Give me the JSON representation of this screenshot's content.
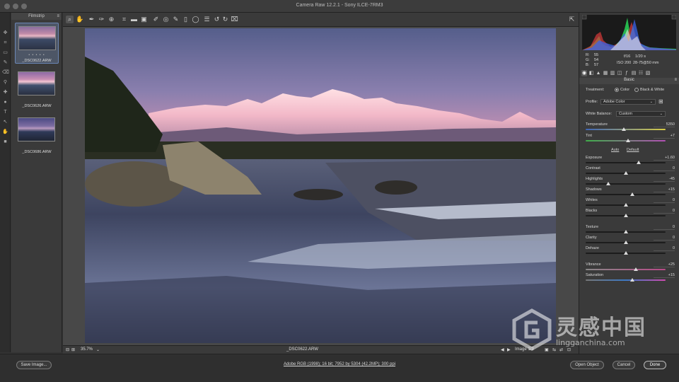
{
  "window": {
    "title": "Camera Raw 12.2.1  -  Sony ILCE-7RM3"
  },
  "filmstrip": {
    "header": "Filmstrip",
    "items": [
      {
        "label": "_DSC0622.ARW",
        "stars": "• • • • •",
        "selected": true
      },
      {
        "label": "_DSC0626.ARW",
        "stars": "",
        "selected": false
      },
      {
        "label": "_DSC0686.ARW",
        "stars": "",
        "selected": false
      }
    ]
  },
  "toolbar": {
    "tools": [
      "zoom-icon",
      "hand-icon",
      "white-balance-icon",
      "color-sampler-icon",
      "target-adjust-icon",
      "crop-icon",
      "straighten-icon",
      "transform-icon",
      "spot-removal-icon",
      "red-eye-icon",
      "adjustment-brush-icon",
      "graduated-filter-icon",
      "radial-filter-icon",
      "preferences-icon",
      "rotate-left-icon",
      "rotate-right-icon",
      "trash-icon"
    ],
    "fullscreen": "fullscreen-icon"
  },
  "canvas": {
    "zoom": "35.7%",
    "filename": "_DSC0622.ARW",
    "image_counter": "Image 1/3"
  },
  "histogram": {
    "r_label": "R:",
    "r_val": "55",
    "g_label": "G:",
    "g_val": "54",
    "b_label": "B:",
    "b_val": "57",
    "aperture": "f/16",
    "shutter": "1/20 s",
    "iso": "ISO 200",
    "lens": "28-75@50 mm"
  },
  "panel": {
    "section_title": "Basic",
    "treatment_label": "Treatment:",
    "treatment_color": "Color",
    "treatment_bw": "Black & White",
    "profile_label": "Profile:",
    "profile_value": "Adobe Color",
    "wb_label": "White Balance:",
    "wb_value": "Custom",
    "auto_label": "Auto",
    "default_label": "Default",
    "sliders": [
      {
        "label": "Temperature",
        "value": "5350",
        "pos": 0.48,
        "style": "temp"
      },
      {
        "label": "Tint",
        "value": "+7",
        "pos": 0.53,
        "style": "tint"
      },
      {
        "label": "Exposure",
        "value": "+1.60",
        "pos": 0.66,
        "style": ""
      },
      {
        "label": "Contrast",
        "value": "0",
        "pos": 0.5,
        "style": ""
      },
      {
        "label": "Highlights",
        "value": "-45",
        "pos": 0.28,
        "style": ""
      },
      {
        "label": "Shadows",
        "value": "+15",
        "pos": 0.58,
        "style": ""
      },
      {
        "label": "Whites",
        "value": "0",
        "pos": 0.5,
        "style": ""
      },
      {
        "label": "Blacks",
        "value": "0",
        "pos": 0.5,
        "style": ""
      },
      {
        "label": "Texture",
        "value": "0",
        "pos": 0.5,
        "style": ""
      },
      {
        "label": "Clarity",
        "value": "0",
        "pos": 0.5,
        "style": ""
      },
      {
        "label": "Dehaze",
        "value": "0",
        "pos": 0.5,
        "style": ""
      },
      {
        "label": "Vibrance",
        "value": "+25",
        "pos": 0.63,
        "style": "vib"
      },
      {
        "label": "Saturation",
        "value": "+15",
        "pos": 0.58,
        "style": "sat"
      }
    ]
  },
  "bottom": {
    "save_label": "Save Image...",
    "workflow": "Adobe RGB (1998); 16 bit; 7952 by 5304 (42.2MP); 300 ppi",
    "open_label": "Open Object",
    "cancel_label": "Cancel",
    "done_label": "Done"
  },
  "watermark": {
    "cn": "灵感中国",
    "en": "lingganchina.com"
  },
  "colors": {
    "accent": "#6b86b5",
    "panel_bg": "#3a3a3a",
    "canvas_bg": "#484848"
  }
}
